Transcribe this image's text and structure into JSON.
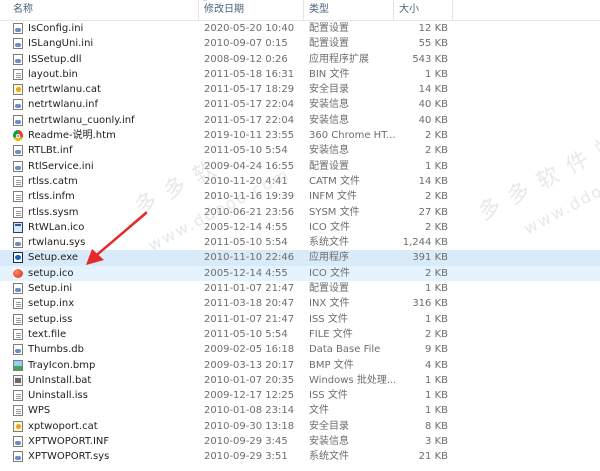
{
  "columns": {
    "name": "名称",
    "date": "修改日期",
    "type": "类型",
    "size": "大小"
  },
  "selected_index": 15,
  "hover_index": 16,
  "files": [
    {
      "name": "IsConfig.ini",
      "date": "2020-05-20 10:40",
      "type": "配置设置",
      "size": "12 KB",
      "icon": "gear"
    },
    {
      "name": "ISLangUni.ini",
      "date": "2010-09-07 0:15",
      "type": "配置设置",
      "size": "55 KB",
      "icon": "gear"
    },
    {
      "name": "ISSetup.dll",
      "date": "2008-09-12 0:26",
      "type": "应用程序扩展",
      "size": "543 KB",
      "icon": "gear"
    },
    {
      "name": "layout.bin",
      "date": "2011-05-18 16:31",
      "type": "BIN 文件",
      "size": "1 KB",
      "icon": "doc"
    },
    {
      "name": "netrtwlanu.cat",
      "date": "2011-05-17 18:29",
      "type": "安全目录",
      "size": "14 KB",
      "icon": "cert"
    },
    {
      "name": "netrtwlanu.inf",
      "date": "2011-05-17 22:04",
      "type": "安装信息",
      "size": "40 KB",
      "icon": "gear"
    },
    {
      "name": "netrtwlanu_cuonly.inf",
      "date": "2011-05-17 22:04",
      "type": "安装信息",
      "size": "40 KB",
      "icon": "gear"
    },
    {
      "name": "Readme-说明.htm",
      "date": "2019-10-11 23:55",
      "type": "360 Chrome HT...",
      "size": "2 KB",
      "icon": "chrome"
    },
    {
      "name": "RTLBt.inf",
      "date": "2011-05-10 5:54",
      "type": "安装信息",
      "size": "2 KB",
      "icon": "gear"
    },
    {
      "name": "RtlService.ini",
      "date": "2009-04-24 16:55",
      "type": "配置设置",
      "size": "1 KB",
      "icon": "gear"
    },
    {
      "name": "rtlss.catm",
      "date": "2010-11-20 4:41",
      "type": "CATM 文件",
      "size": "14 KB",
      "icon": "doc"
    },
    {
      "name": "rtlss.infm",
      "date": "2010-11-16 19:39",
      "type": "INFM 文件",
      "size": "2 KB",
      "icon": "doc"
    },
    {
      "name": "rtlss.sysm",
      "date": "2010-06-21 23:56",
      "type": "SYSM 文件",
      "size": "27 KB",
      "icon": "doc"
    },
    {
      "name": "RtWLan.ico",
      "date": "2005-12-14 4:55",
      "type": "ICO 文件",
      "size": "2 KB",
      "icon": "exe"
    },
    {
      "name": "rtwlanu.sys",
      "date": "2011-05-10 5:54",
      "type": "系统文件",
      "size": "1,244 KB",
      "icon": "gear"
    },
    {
      "name": "Setup.exe",
      "date": "2010-11-10 22:46",
      "type": "应用程序",
      "size": "391 KB",
      "icon": "setup"
    },
    {
      "name": "setup.ico",
      "date": "2005-12-14 4:55",
      "type": "ICO 文件",
      "size": "2 KB",
      "icon": "red"
    },
    {
      "name": "Setup.ini",
      "date": "2011-01-07 21:47",
      "type": "配置设置",
      "size": "1 KB",
      "icon": "gear"
    },
    {
      "name": "setup.inx",
      "date": "2011-03-18 20:47",
      "type": "INX 文件",
      "size": "316 KB",
      "icon": "doc"
    },
    {
      "name": "setup.iss",
      "date": "2011-01-07 21:47",
      "type": "ISS 文件",
      "size": "1 KB",
      "icon": "doc"
    },
    {
      "name": "text.file",
      "date": "2011-05-10 5:54",
      "type": "FILE 文件",
      "size": "2 KB",
      "icon": "doc"
    },
    {
      "name": "Thumbs.db",
      "date": "2009-02-05 16:18",
      "type": "Data Base File",
      "size": "9 KB",
      "icon": "gear"
    },
    {
      "name": "TrayIcon.bmp",
      "date": "2009-03-13 20:17",
      "type": "BMP 文件",
      "size": "4 KB",
      "icon": "bmp"
    },
    {
      "name": "UnInstall.bat",
      "date": "2010-01-07 20:35",
      "type": "Windows 批处理...",
      "size": "1 KB",
      "icon": "bat"
    },
    {
      "name": "Uninstall.iss",
      "date": "2009-12-17 12:25",
      "type": "ISS 文件",
      "size": "1 KB",
      "icon": "doc"
    },
    {
      "name": "WPS",
      "date": "2010-01-08 23:14",
      "type": "文件",
      "size": "1 KB",
      "icon": "doc"
    },
    {
      "name": "xptwoport.cat",
      "date": "2010-09-30 13:18",
      "type": "安全目录",
      "size": "8 KB",
      "icon": "cert"
    },
    {
      "name": "XPTWOPORT.INF",
      "date": "2010-09-29 3:45",
      "type": "安装信息",
      "size": "3 KB",
      "icon": "gear"
    },
    {
      "name": "XPTWOPORT.sys",
      "date": "2010-09-29 3:51",
      "type": "系统文件",
      "size": "21 KB",
      "icon": "gear"
    }
  ]
}
